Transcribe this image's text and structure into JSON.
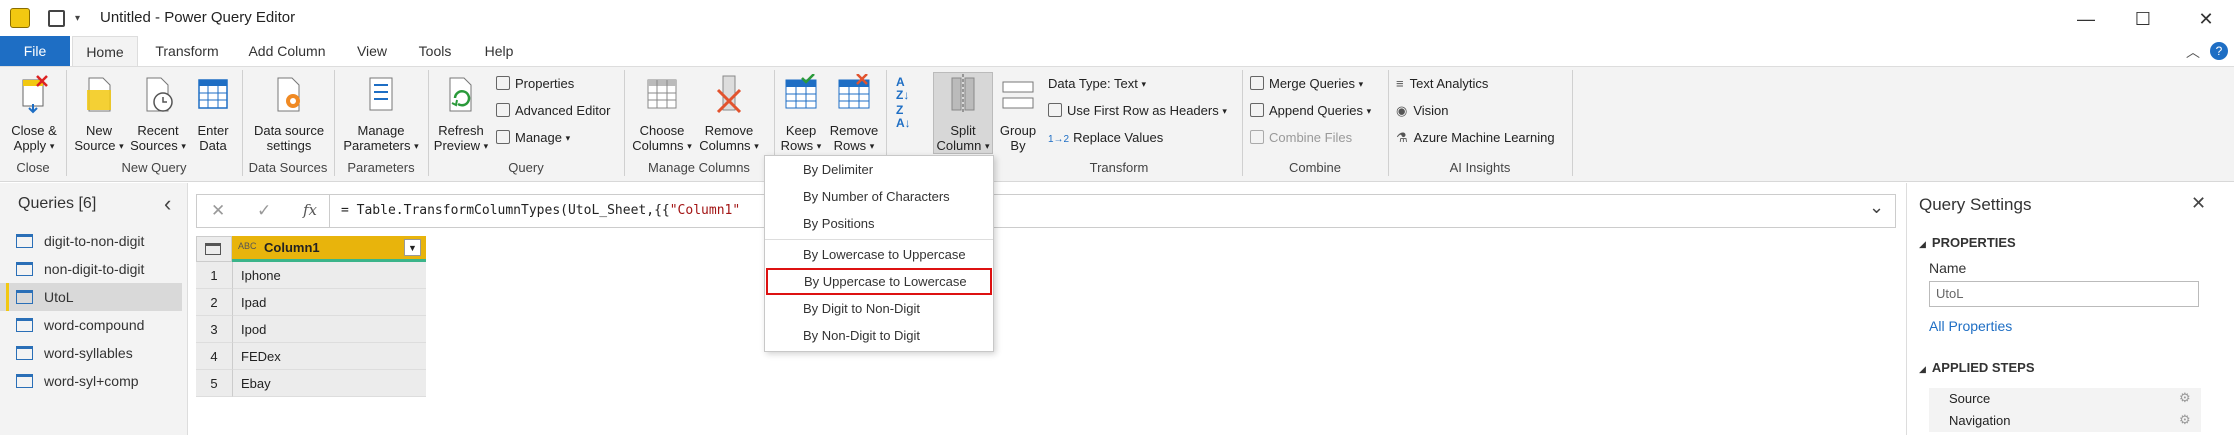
{
  "window": {
    "title": "Untitled - Power Query Editor",
    "minimize": "—",
    "maximize": "☐",
    "close": "✕"
  },
  "menu": {
    "tabs": [
      "File",
      "Home",
      "Transform",
      "Add Column",
      "View",
      "Tools",
      "Help"
    ]
  },
  "ribbon": {
    "close_apply": {
      "l1": "Close &",
      "l2": "Apply"
    },
    "new_source": {
      "l1": "New",
      "l2": "Source"
    },
    "recent_sources": {
      "l1": "Recent",
      "l2": "Sources"
    },
    "enter_data": {
      "l1": "Enter",
      "l2": "Data"
    },
    "data_source_settings": {
      "l1": "Data source",
      "l2": "settings"
    },
    "manage_parameters": {
      "l1": "Manage",
      "l2": "Parameters"
    },
    "refresh_preview": {
      "l1": "Refresh",
      "l2": "Preview"
    },
    "properties": "Properties",
    "advanced_editor": "Advanced Editor",
    "manage": "Manage",
    "choose_columns": {
      "l1": "Choose",
      "l2": "Columns"
    },
    "remove_columns": {
      "l1": "Remove",
      "l2": "Columns"
    },
    "keep_rows": {
      "l1": "Keep",
      "l2": "Rows"
    },
    "remove_rows": {
      "l1": "Remove",
      "l2": "Rows"
    },
    "split_column": {
      "l1": "Split",
      "l2": "Column"
    },
    "group_by": {
      "l1": "Group",
      "l2": "By"
    },
    "data_type": "Data Type: Text",
    "use_first_row": "Use First Row as Headers",
    "replace_values": "Replace Values",
    "merge_queries": "Merge Queries",
    "append_queries": "Append Queries",
    "combine_files": "Combine Files",
    "text_analytics": "Text Analytics",
    "vision": "Vision",
    "azure_ml": "Azure Machine Learning",
    "groups": {
      "close": "Close",
      "new_query": "New Query",
      "data_sources": "Data Sources",
      "parameters": "Parameters",
      "query": "Query",
      "manage_columns": "Manage Columns",
      "transform": "Transform",
      "combine": "Combine",
      "ai_insights": "AI Insights"
    }
  },
  "queries": {
    "header": "Queries [6]",
    "collapse": "‹",
    "items": [
      "digit-to-non-digit",
      "non-digit-to-digit",
      "UtoL",
      "word-compound",
      "word-syllables",
      "word-syl+comp"
    ],
    "selected_index": 2
  },
  "formula": {
    "text": "= Table.TransformColumnTypes(UtoL_Sheet,{{\"Column1\"",
    "string_part": "\"Column1\"",
    "cancel": "✕",
    "commit": "✓",
    "fx": "fx",
    "expand": "⌄"
  },
  "grid": {
    "header": "Column1",
    "type_icon": "ABC",
    "rows": [
      {
        "n": "1",
        "v": "Iphone"
      },
      {
        "n": "2",
        "v": "Ipad"
      },
      {
        "n": "3",
        "v": "Ipod"
      },
      {
        "n": "4",
        "v": "FEDex"
      },
      {
        "n": "5",
        "v": "Ebay"
      }
    ]
  },
  "split_menu": {
    "items": [
      "By Delimiter",
      "By Number of Characters",
      "By Positions",
      "By Lowercase to Uppercase",
      "By Uppercase to Lowercase",
      "By Digit to Non-Digit",
      "By Non-Digit to Digit"
    ],
    "highlighted_index": 4
  },
  "settings": {
    "title": "Query Settings",
    "close": "✕",
    "properties": "PROPERTIES",
    "name_label": "Name",
    "name_value": "UtoL",
    "all_properties": "All Properties",
    "applied_steps": "APPLIED STEPS",
    "steps": [
      "Source",
      "Navigation"
    ]
  },
  "colors": {
    "accent_blue": "#1e6ec4",
    "highlight_yellow": "#f2c811",
    "menu_highlight": "#dd1111"
  }
}
